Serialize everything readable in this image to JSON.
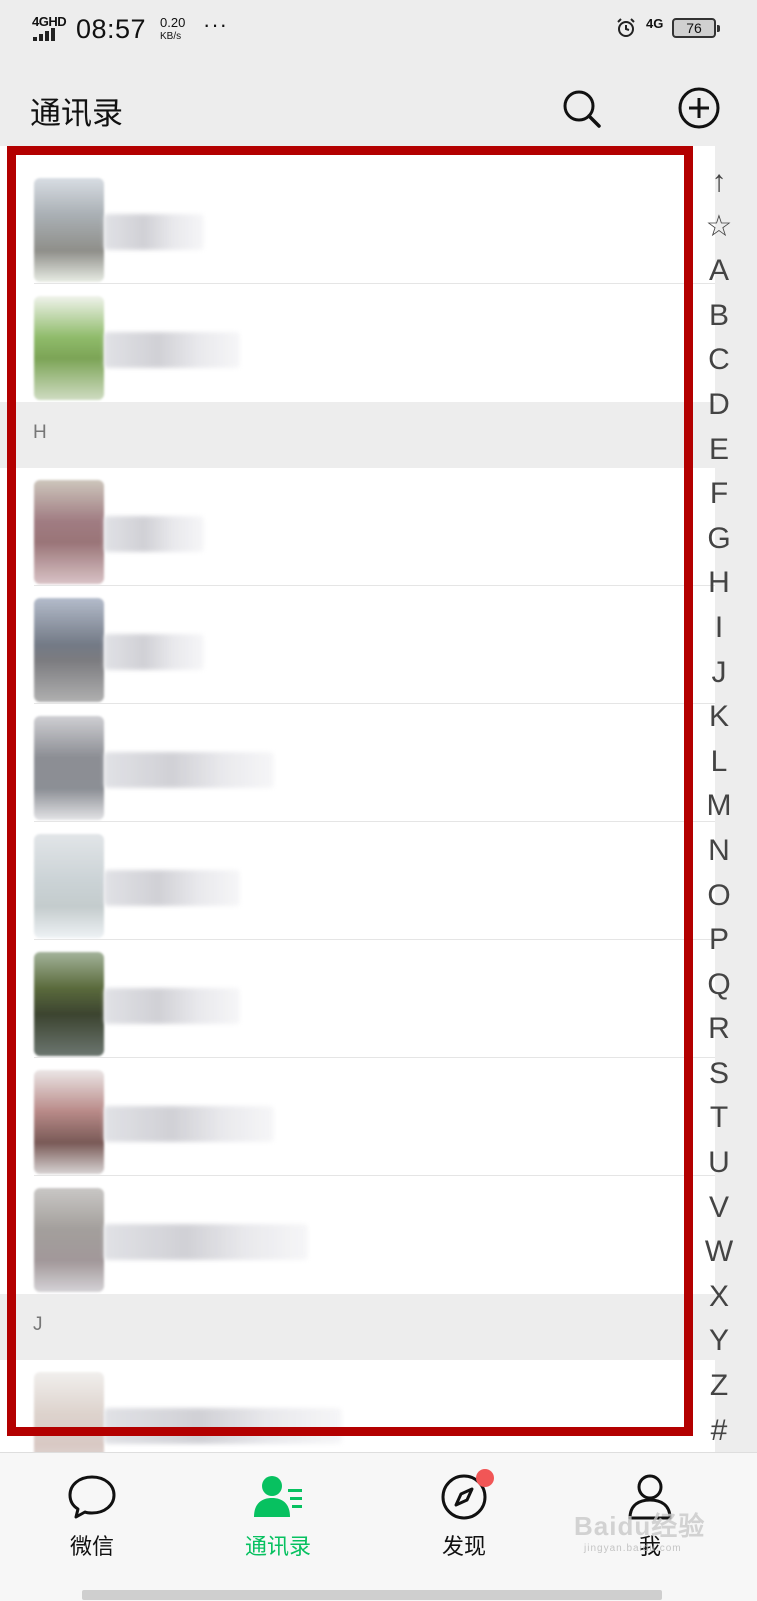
{
  "status_bar": {
    "network": "4GHD",
    "time": "08:57",
    "speed_value": "0.20",
    "speed_unit": "KB/s",
    "more": "···",
    "network_right": "4G",
    "battery": "76"
  },
  "header": {
    "title": "通讯录"
  },
  "sections": {
    "h": "H",
    "j": "J"
  },
  "index_letters": [
    "↑",
    "☆",
    "A",
    "B",
    "C",
    "D",
    "E",
    "F",
    "G",
    "H",
    "I",
    "J",
    "K",
    "L",
    "M",
    "N",
    "O",
    "P",
    "Q",
    "R",
    "S",
    "T",
    "U",
    "V",
    "W",
    "X",
    "Y",
    "Z",
    "#"
  ],
  "tabs": {
    "chats": "微信",
    "contacts": "通讯录",
    "discover": "发现",
    "me": "我"
  },
  "colors": {
    "accent": "#07c160",
    "highlight_border": "#b30000",
    "badge": "#f15656"
  },
  "watermark": {
    "brand": "Baidu经验",
    "url": "jingyan.baidu.com"
  }
}
